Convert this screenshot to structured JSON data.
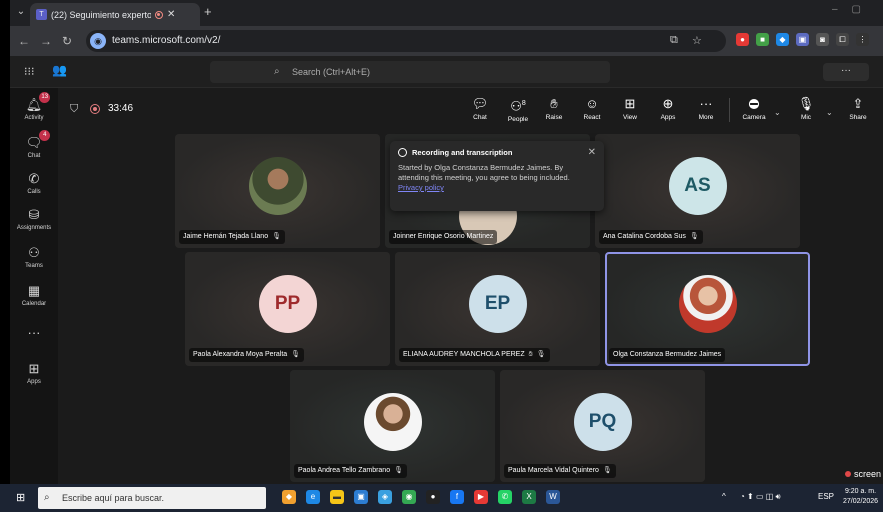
{
  "browser": {
    "tab_title": "(22) Seguimiento expertos",
    "new_tab": "+",
    "url": "teams.microsoft.com/v2/"
  },
  "teams": {
    "search_placeholder": "Search (Ctrl+Alt+E)",
    "more": "···"
  },
  "rail": [
    {
      "label": "Activity",
      "icon": "bell-icon",
      "badge": "13"
    },
    {
      "label": "Chat",
      "icon": "chat-icon",
      "badge": "4"
    },
    {
      "label": "Calls",
      "icon": "phone-icon",
      "badge": ""
    },
    {
      "label": "Assignments",
      "icon": "bag-icon",
      "badge": ""
    },
    {
      "label": "Teams",
      "icon": "people-icon",
      "badge": ""
    },
    {
      "label": "Calendar",
      "icon": "calendar-icon",
      "badge": ""
    },
    {
      "label": "Apps",
      "icon": "plus-box-icon",
      "badge": ""
    }
  ],
  "meeting": {
    "timer": "33:46",
    "controls": {
      "chat": "Chat",
      "people": "People",
      "people_count": "8",
      "raise": "Raise",
      "react": "React",
      "view": "View",
      "apps": "Apps",
      "more": "More",
      "camera": "Camera",
      "mic": "Mic",
      "share": "Share"
    }
  },
  "popup": {
    "title": "Recording and transcription",
    "body": "Started by Olga Constanza Bermudez Jaimes. By attending this meeting, you agree to being included.",
    "link": "Privacy policy"
  },
  "participants": [
    {
      "name": "Jaime Hernán Tejada Llano",
      "initials": "",
      "muted": true
    },
    {
      "name": "Joinner Enrique Osorio Martinez",
      "initials": "",
      "muted": false
    },
    {
      "name": "Ana Catalina Cordoba Sus",
      "initials": "AS",
      "muted": true
    },
    {
      "name": "Paola Alexandra Moya Peralta",
      "initials": "PP",
      "muted": true
    },
    {
      "name": "ELIANA AUDREY MANCHOLA PEREZ",
      "initials": "EP",
      "muted": true
    },
    {
      "name": "Olga Constanza Bermudez Jaimes",
      "initials": "",
      "muted": false
    },
    {
      "name": "Paola Andrea Tello Zambrano",
      "initials": "",
      "muted": true
    },
    {
      "name": "Paula Marcela Vidal Quintero",
      "initials": "PQ",
      "muted": true
    }
  ],
  "recording_tag": "screen",
  "taskbar": {
    "search_placeholder": "Escribe aquí para buscar.",
    "lang": "ESP",
    "time": "9:20 a. m.",
    "date": "27/02/2026"
  }
}
